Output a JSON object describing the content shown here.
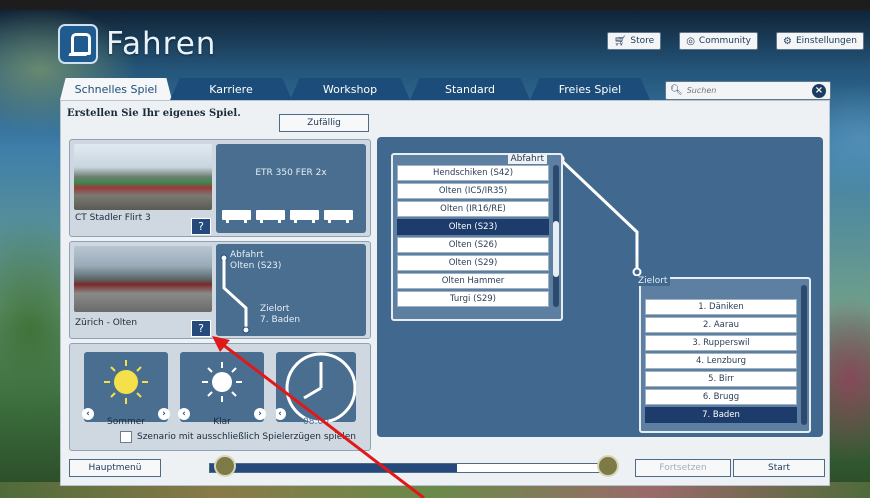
{
  "header": {
    "title": "Fahren",
    "buttons": [
      {
        "label": "Store",
        "icon": "cart-icon"
      },
      {
        "label": "Community",
        "icon": "globe-icon"
      },
      {
        "label": "Einstellungen",
        "icon": "gear-icon"
      }
    ]
  },
  "tabs": [
    {
      "label": "Schnelles Spiel",
      "active": true
    },
    {
      "label": "Karriere",
      "active": false
    },
    {
      "label": "Workshop",
      "active": false
    },
    {
      "label": "Standard",
      "active": false
    },
    {
      "label": "Freies Spiel",
      "active": false
    }
  ],
  "search": {
    "placeholder": "Suchen"
  },
  "panel": {
    "subtitle": "Erstellen Sie Ihr eigenes Spiel.",
    "random_button": "Zufällig"
  },
  "train": {
    "name": "CT Stadler Flirt 3",
    "consist": "ETR 350 FER 2x",
    "help": "?"
  },
  "route": {
    "name": "Zürich - Olten",
    "help": "?",
    "departure_label": "Abfahrt",
    "departure_value": "Olten (S23)",
    "destination_label": "Zielort",
    "destination_value": "7. Baden"
  },
  "environment": {
    "season": "Sommer",
    "weather": "Klar",
    "time": "08:00",
    "checkbox_label": "Szenario mit ausschließlich Spielerzügen spielen"
  },
  "departure_list": {
    "header": "Abfahrt",
    "items": [
      "Hendschiken (S42)",
      "Olten (IC5/IR35)",
      "Olten (IR16/RE)",
      "Olten (S23)",
      "Olten (S26)",
      "Olten (S29)",
      "Olten Hammer",
      "Turgi (S29)"
    ],
    "selected": "Olten (S23)"
  },
  "destination_list": {
    "header": "Zielort",
    "items": [
      "1. Däniken",
      "2. Aarau",
      "3. Rupperswil",
      "4. Lenzburg",
      "5. Birr",
      "6. Brugg",
      "7. Baden"
    ],
    "selected": "7. Baden"
  },
  "footer": {
    "main_menu": "Hauptmenü",
    "continue": "Fortsetzen",
    "start": "Start",
    "progress": 0.62
  },
  "colors": {
    "accent": "#1c4d7a",
    "tile": "#4a6e90",
    "selected": "#1d3c6b",
    "annotation_arrow": "#e01818"
  }
}
